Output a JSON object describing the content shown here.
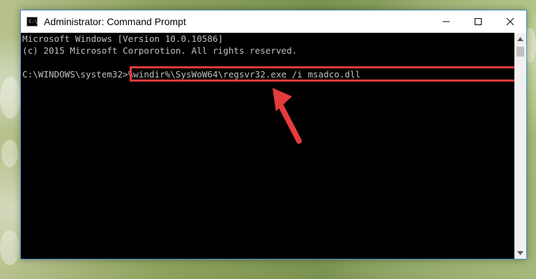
{
  "window": {
    "title": "Administrator: Command Prompt",
    "app_icon_glyph": "C:\\"
  },
  "controls": {
    "minimize_icon": "minimize-icon",
    "maximize_icon": "maximize-icon",
    "close_icon": "close-icon"
  },
  "console": {
    "lines": [
      "Microsoft Windows [Version 10.0.10586]",
      "(c) 2015 Microsoft Corporotion. All rights reserved."
    ],
    "prompt": "C:\\WINDOWS\\system32>",
    "command": "%windir%\\SysWoW64\\regsvr32.exe /i msadco.dll"
  },
  "colors": {
    "console_bg": "#000000",
    "console_text": "#c0c0c0",
    "highlight": "#e53b3b",
    "window_border": "#4a90c9"
  }
}
